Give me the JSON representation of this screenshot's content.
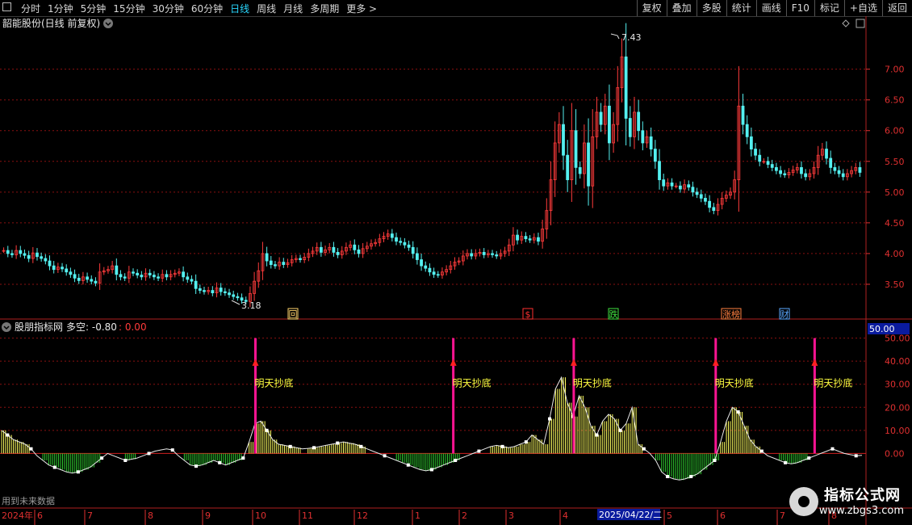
{
  "toolbar": {
    "periods": [
      "分时",
      "1分钟",
      "5分钟",
      "15分钟",
      "30分钟",
      "60分钟",
      "日线",
      "周线",
      "月线",
      "多周期",
      "更多 >"
    ],
    "active_period": "日线",
    "right_buttons": [
      "复权",
      "叠加",
      "多股",
      "统计",
      "画线",
      "F10",
      "标记",
      "+自选",
      "返回"
    ]
  },
  "main_title": "韶能股份(日线 前复权)",
  "indicator_title": "股朋指标网",
  "indicator_label": "多空: -0.80",
  "indicator_value2": ": 0.00",
  "indicator_badge": "50.00",
  "footer_note": "用到未来数据",
  "signal_text": "明天抄底",
  "price_axis": [
    "7.00",
    "6.50",
    "6.00",
    "5.50",
    "5.00",
    "4.50",
    "4.00",
    "3.50"
  ],
  "ind_axis": [
    "50.00",
    "40.00",
    "30.00",
    "20.00",
    "10.00",
    "0.00"
  ],
  "price_high_label": "7.43",
  "price_low_label": "3.18",
  "event_marks": [
    {
      "text": "回",
      "color": "#ffd36b"
    },
    {
      "text": "$",
      "color": "#ff3030"
    },
    {
      "text": "跌",
      "color": "#40e040"
    },
    {
      "text": "涨榜",
      "color": "#ff8040"
    },
    {
      "text": "财",
      "color": "#5aa8ff"
    }
  ],
  "date_axis": {
    "year": "2024年",
    "months": [
      "6",
      "7",
      "8",
      "9",
      "10",
      "11",
      "12",
      "1",
      "2",
      "3",
      "4",
      "5",
      "6",
      "7",
      "8"
    ],
    "cursor_date": "2025/04/22/二"
  },
  "watermark": {
    "line1": "指标公式网",
    "line2": "www.zbgs3.com"
  },
  "colors": {
    "up": "#ff3b3b",
    "down": "#54f0f0",
    "grid": "#8a1010",
    "signal": "#ff1493",
    "label": "#ffff40",
    "axis_red": "#e03030"
  },
  "chart_data": {
    "type": "candlestick",
    "y_range": [
      3.0,
      7.6
    ],
    "closes": [
      4.05,
      4.0,
      3.98,
      4.05,
      4.0,
      3.97,
      3.92,
      4.01,
      3.95,
      3.92,
      3.88,
      3.8,
      3.74,
      3.78,
      3.75,
      3.7,
      3.66,
      3.6,
      3.56,
      3.62,
      3.58,
      3.55,
      3.52,
      3.7,
      3.72,
      3.74,
      3.8,
      3.66,
      3.62,
      3.6,
      3.7,
      3.68,
      3.65,
      3.62,
      3.68,
      3.65,
      3.62,
      3.6,
      3.66,
      3.62,
      3.66,
      3.68,
      3.7,
      3.62,
      3.58,
      3.55,
      3.43,
      3.4,
      3.38,
      3.4,
      3.36,
      3.44,
      3.38,
      3.36,
      3.33,
      3.3,
      3.28,
      3.24,
      3.22,
      3.35,
      3.55,
      3.72,
      4.0,
      3.88,
      3.82,
      3.8,
      3.86,
      3.82,
      3.85,
      3.9,
      3.92,
      3.9,
      3.94,
      4.0,
      4.04,
      4.1,
      4.02,
      4.06,
      4.1,
      4.02,
      3.98,
      4.04,
      4.1,
      4.14,
      4.06,
      4.0,
      4.08,
      4.12,
      4.16,
      4.18,
      4.24,
      4.28,
      4.32,
      4.26,
      4.2,
      4.18,
      4.14,
      4.1,
      4.0,
      3.9,
      3.8,
      3.76,
      3.7,
      3.66,
      3.65,
      3.7,
      3.74,
      3.8,
      3.86,
      3.88,
      3.96,
      4.0,
      3.96,
      4.0,
      4.02,
      3.98,
      4.0,
      3.98,
      3.96,
      4.0,
      4.04,
      4.14,
      4.3,
      4.22,
      4.28,
      4.24,
      4.22,
      4.26,
      4.2,
      4.4,
      4.7,
      5.2,
      5.8,
      6.1,
      5.6,
      5.2,
      6.0,
      5.4,
      5.3,
      5.8,
      5.1,
      5.9,
      6.3,
      6.1,
      6.4,
      5.8,
      6.1,
      6.7,
      7.2,
      6.2,
      5.9,
      6.3,
      6.0,
      5.8,
      5.9,
      5.7,
      5.5,
      5.2,
      5.1,
      5.15,
      5.1,
      5.1,
      5.05,
      5.12,
      5.08,
      5.0,
      4.96,
      4.9,
      4.85,
      4.75,
      4.7,
      4.8,
      4.9,
      4.95,
      5.0,
      5.2,
      6.4,
      6.1,
      5.9,
      5.7,
      5.6,
      5.5,
      5.5,
      5.45,
      5.4,
      5.35,
      5.3,
      5.28,
      5.32,
      5.36,
      5.4,
      5.3,
      5.25,
      5.3,
      5.4,
      5.6,
      5.7,
      5.55,
      5.4,
      5.35,
      5.3,
      5.25,
      5.3,
      5.35,
      5.4,
      5.32
    ]
  },
  "indicator_data": {
    "type": "line",
    "values": [
      10,
      8,
      6,
      5,
      4,
      2,
      -1,
      -3,
      -5,
      -6,
      -7,
      -8,
      -8.5,
      -8,
      -7,
      -6,
      -4,
      -2,
      0,
      -1,
      -2,
      -3,
      -2.5,
      -2,
      -1,
      0,
      1,
      1.5,
      2,
      1.5,
      -1,
      -3,
      -5,
      -5.5,
      -5,
      -4,
      -3,
      -4,
      -5,
      -4,
      -3,
      -2,
      5,
      13,
      14,
      10,
      6,
      4,
      3.5,
      3,
      2.5,
      2,
      2.2,
      2.5,
      3,
      3.5,
      4,
      4.5,
      5,
      4.5,
      4,
      3,
      2,
      1,
      0,
      -1,
      -2,
      -3,
      -4,
      -5,
      -6,
      -7,
      -7.5,
      -7,
      -6,
      -5,
      -4,
      -3,
      -2,
      -1,
      0,
      1,
      2,
      3,
      3.5,
      3,
      2.5,
      3,
      4,
      5,
      8,
      6,
      4,
      15,
      28,
      33,
      22,
      16,
      25,
      20,
      12,
      8,
      14,
      17,
      15,
      10,
      13,
      20,
      4,
      2,
      0,
      -3,
      -8,
      -10,
      -11,
      -11.5,
      -11,
      -10,
      -9,
      -7,
      -5,
      -3,
      5,
      14,
      20,
      18,
      12,
      6,
      3,
      1,
      -1,
      -2,
      -3,
      -4,
      -4.5,
      -4,
      -3,
      -2,
      -1,
      0,
      1,
      2,
      1,
      0,
      -0.5,
      -1,
      -0.8
    ],
    "bottom_signals": [
      0.295,
      0.525,
      0.665,
      0.83,
      0.945
    ]
  }
}
